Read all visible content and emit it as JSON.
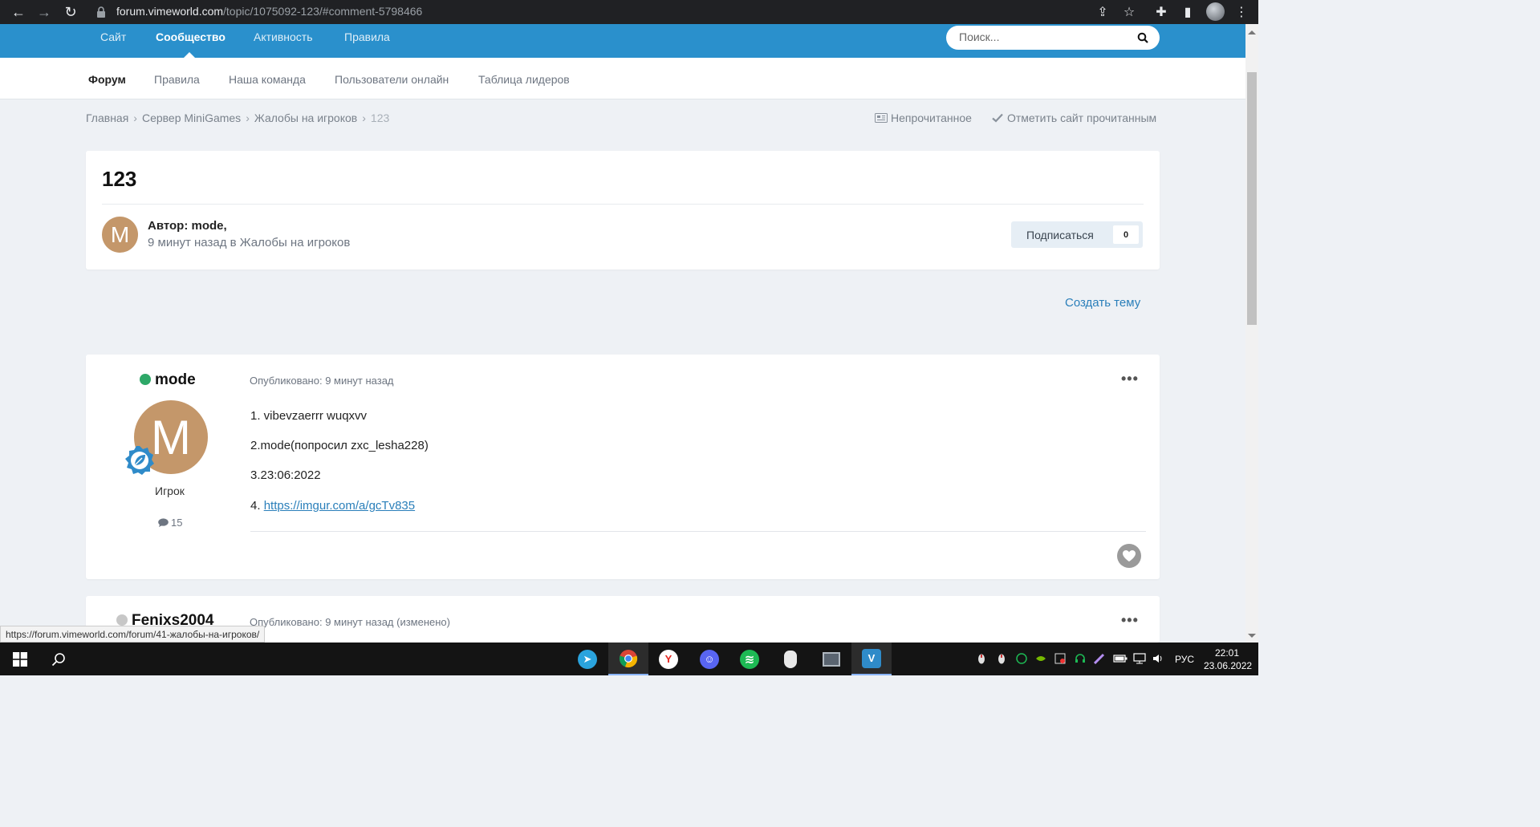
{
  "browser": {
    "url_host": "forum.vimeworld.com",
    "url_path": "/topic/1075092-123/#comment-5798466"
  },
  "header": {
    "tabs": [
      {
        "label": "Сайт"
      },
      {
        "label": "Сообщество"
      },
      {
        "label": "Активность"
      },
      {
        "label": "Правила"
      }
    ],
    "search_placeholder": "Поиск..."
  },
  "subnav": {
    "items": [
      {
        "label": "Форум"
      },
      {
        "label": "Правила"
      },
      {
        "label": "Наша команда"
      },
      {
        "label": "Пользователи онлайн"
      },
      {
        "label": "Таблица лидеров"
      }
    ]
  },
  "breadcrumb": {
    "items": [
      "Главная",
      "Сервер MiniGames",
      "Жалобы на игроков"
    ],
    "current": "123",
    "sep": "›",
    "unread": "Непрочитанное",
    "mark_read": "Отметить сайт прочитанным"
  },
  "topic": {
    "title": "123",
    "avatar_letter": "M",
    "author_line": "Автор: mode,",
    "meta_time": "9 минут назад",
    "meta_in": "в",
    "meta_forum": "Жалобы на игроков",
    "subscribe_label": "Подписаться",
    "subscribe_count": "0"
  },
  "create_topic": "Создать тему",
  "posts": [
    {
      "author": "mode",
      "online": true,
      "avatar_letter": "M",
      "rank": "Игрок",
      "post_count": "15",
      "published": "Опубликовано: 9 минут назад",
      "lines": [
        "1. vibevzaerrr  wuqxvv",
        "2.mode(попросил zxc_lesha228)",
        "3.23:06:2022"
      ],
      "link_prefix": "4. ",
      "link": "https://imgur.com/a/gcTv835"
    },
    {
      "author": "Fenixs2004",
      "online": false,
      "published": "Опубликовано: 9 минут назад (изменено)"
    }
  ],
  "status_url": "https://forum.vimeworld.com/forum/41-жалобы-на-игроков/",
  "taskbar": {
    "lang": "РУС",
    "time": "22:01",
    "date": "23.06.2022"
  },
  "colors": {
    "brand_blue": "#2a90cc",
    "link": "#2a7fba",
    "online": "#2ea868",
    "offline": "#c7c7c7",
    "avatar": "#c4976a"
  }
}
